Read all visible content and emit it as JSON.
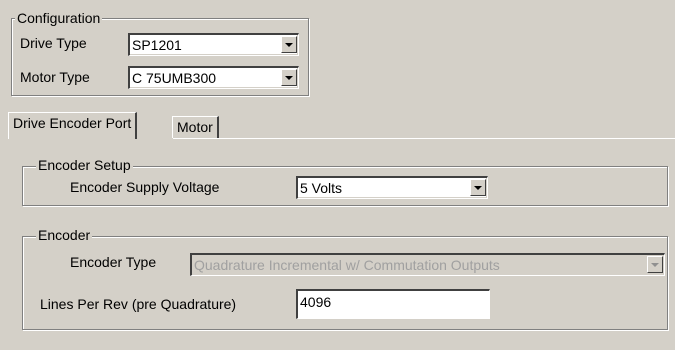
{
  "configuration": {
    "legend": "Configuration",
    "drive_type_label": "Drive Type",
    "drive_type_value": "SP1201",
    "motor_type_label": "Motor Type",
    "motor_type_value": "C 75UMB300"
  },
  "tabs": [
    {
      "label": "Drive Encoder Port",
      "selected": true
    },
    {
      "label": "Motor",
      "selected": false
    }
  ],
  "encoder_setup": {
    "legend": "Encoder Setup",
    "supply_voltage_label": "Encoder Supply Voltage",
    "supply_voltage_value": "5 Volts"
  },
  "encoder": {
    "legend": "Encoder",
    "type_label": "Encoder Type",
    "type_value": "Quadrature Incremental w/ Commutation Outputs",
    "lines_label": "Lines Per Rev (pre Quadrature)",
    "lines_value": "4096"
  },
  "icons": [
    "chevron-down-icon"
  ]
}
